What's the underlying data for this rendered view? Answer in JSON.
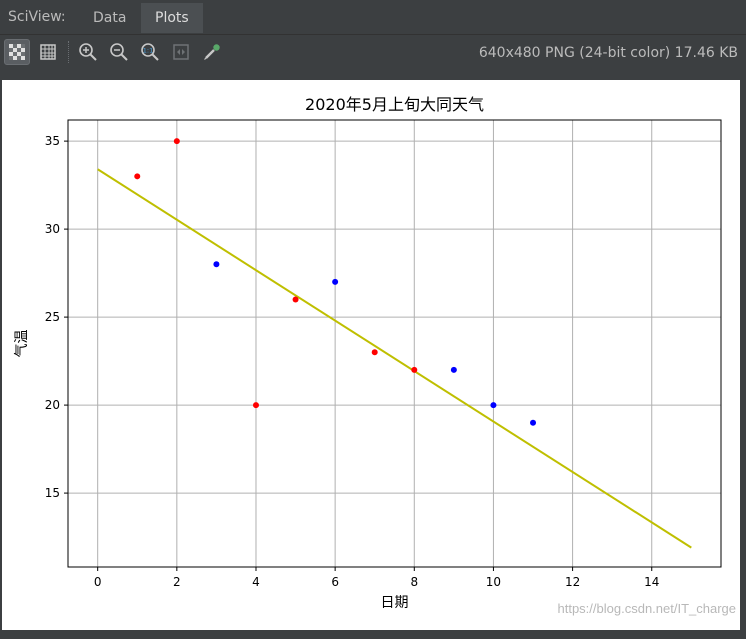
{
  "app": {
    "label": "SciView:",
    "tabs": [
      {
        "label": "Data",
        "active": false
      },
      {
        "label": "Plots",
        "active": true
      }
    ]
  },
  "toolbar": {
    "buttons": [
      {
        "name": "checkerboard-icon",
        "active": true
      },
      {
        "name": "grid-icon",
        "active": false
      },
      {
        "name": "zoom-in-icon",
        "active": false
      },
      {
        "name": "zoom-out-icon",
        "active": false
      },
      {
        "name": "actual-size-icon",
        "active": false
      },
      {
        "name": "fit-screen-icon",
        "active": false
      },
      {
        "name": "color-picker-icon",
        "active": false
      }
    ],
    "image_info": "640x480 PNG (24-bit color) 17.46 KB"
  },
  "watermark": "https://blog.csdn.net/IT_charge",
  "chart_data": {
    "type": "scatter",
    "title": "2020年5月上旬大同天气",
    "xlabel": "日期",
    "ylabel": "气温",
    "xlim": [
      -0.75,
      15.75
    ],
    "ylim": [
      10.8,
      36.2
    ],
    "xticks": [
      "0",
      "2",
      "4",
      "6",
      "8",
      "10",
      "12",
      "14"
    ],
    "yticks": [
      "15",
      "20",
      "25",
      "30",
      "35"
    ],
    "grid": true,
    "series": [
      {
        "color": "#ff0000",
        "points": [
          [
            1,
            33
          ],
          [
            2,
            35
          ],
          [
            4,
            20
          ],
          [
            5,
            26
          ],
          [
            7,
            23
          ],
          [
            8,
            22
          ]
        ]
      },
      {
        "color": "#0000ff",
        "points": [
          [
            3,
            28
          ],
          [
            6,
            27
          ],
          [
            9,
            22
          ],
          [
            10,
            20
          ],
          [
            11,
            19
          ]
        ]
      }
    ],
    "fit_line": {
      "color": "#bfbf00",
      "x": [
        0,
        15
      ],
      "y": [
        33.4,
        11.9
      ]
    }
  }
}
